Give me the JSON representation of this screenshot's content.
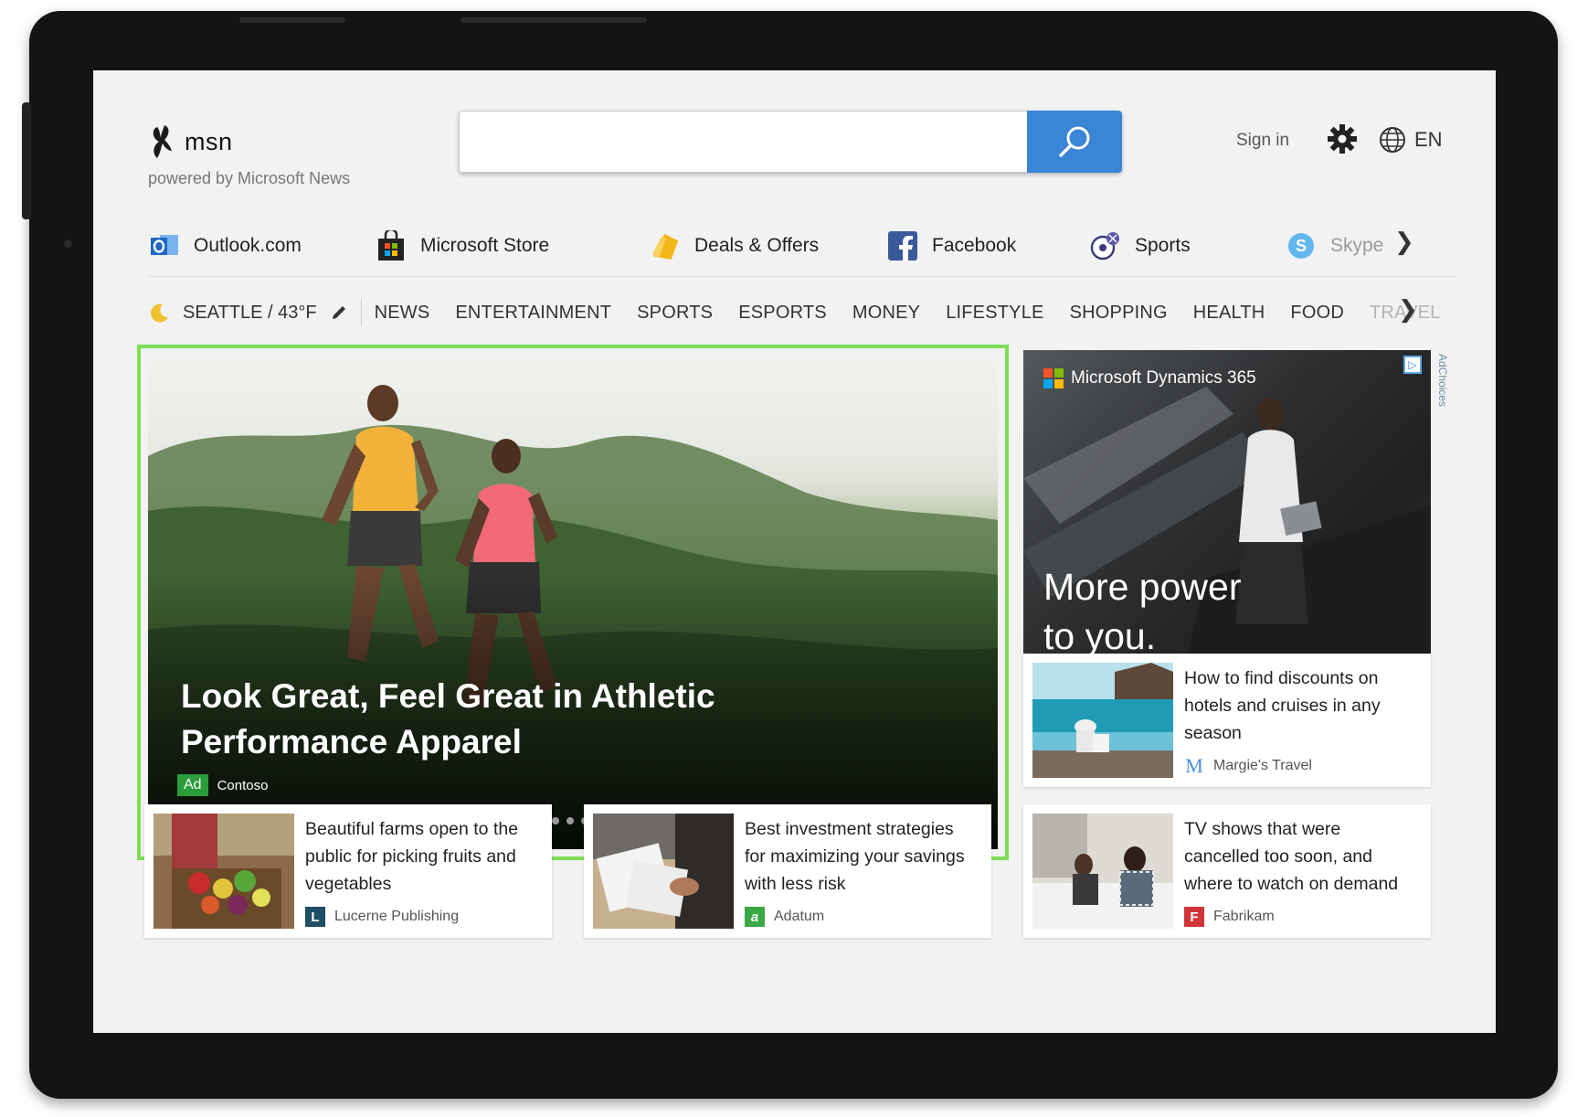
{
  "header": {
    "logo_text": "msn",
    "powered_by": "powered by Microsoft News",
    "search_placeholder": "",
    "sign_in": "Sign in",
    "language": "EN"
  },
  "quick_links": [
    {
      "label": "Outlook.com",
      "icon": "outlook-icon"
    },
    {
      "label": "Microsoft Store",
      "icon": "store-icon"
    },
    {
      "label": "Deals & Offers",
      "icon": "deals-icon"
    },
    {
      "label": "Facebook",
      "icon": "facebook-icon"
    },
    {
      "label": "Sports",
      "icon": "sports-icon"
    },
    {
      "label": "Skype",
      "icon": "skype-icon"
    }
  ],
  "weather": {
    "location": "SEATTLE / 43°F"
  },
  "categories": [
    "NEWS",
    "ENTERTAINMENT",
    "SPORTS",
    "ESPORTS",
    "MONEY",
    "LIFESTYLE",
    "SHOPPING",
    "HEALTH",
    "FOOD",
    "TRAVEL"
  ],
  "hero": {
    "title": "Look Great, Feel Great in Athletic Performance Apparel",
    "badge": "Ad",
    "source": "Contoso",
    "dot_count": 30,
    "active_dot": 10
  },
  "ad": {
    "brand": "Microsoft Dynamics 365",
    "headline": "More power to you.",
    "adchoices": "AdChoices"
  },
  "cards": [
    {
      "title": "How to find discounts on hotels and cruises in any season",
      "source": "Margie's Travel",
      "src_letter": "M",
      "src_color": "#4a8ed6"
    },
    {
      "title": "Beautiful farms open to the public for picking fruits and vegetables",
      "source": "Lucerne Publishing",
      "src_letter": "L",
      "src_color": "#1f4f64"
    },
    {
      "title": "Best investment strategies for maximizing your savings with less risk",
      "source": "Adatum",
      "src_letter": "a",
      "src_color": "#3aa845"
    },
    {
      "title": "TV shows that were cancelled too soon, and where to watch on demand",
      "source": "Fabrikam",
      "src_letter": "F",
      "src_color": "#d13438"
    }
  ],
  "colors": {
    "accent": "#3a85d6",
    "highlight": "#7ddd57"
  }
}
